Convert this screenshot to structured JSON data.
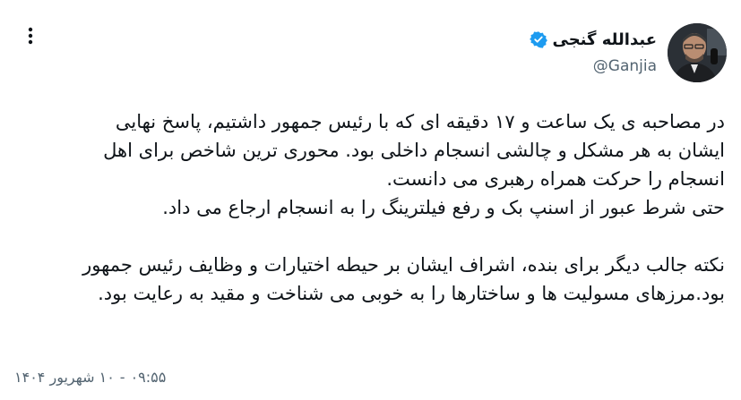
{
  "author": {
    "display_name": "عبدالله گنجی",
    "handle": "@Ganjia",
    "verified": true,
    "verified_color": "#1d9bf0"
  },
  "tweet": {
    "paragraph1": [
      "در مصاحبه ی یک ساعت و ۱۷ دقیقه ای که با رئیس جمهور  داشتیم، پاسخ نهایی",
      "ایشان به هر مشکل و چالشی انسجام داخلی بود. محوری ترین شاخص برای اهل",
      "انسجام را حرکت همراه رهبری می دانست.",
      "حتی شرط عبور از اسنپ بک و رفع فیلترینگ را به انسجام ارجاع می داد."
    ],
    "paragraph2": [
      "نکته جالب دیگر برای بنده، اشراف ایشان بر حیطه اختیارات و وظایف رئیس جمهور",
      "بود.مرزهای مسولیت ها و ساختارها را به خوبی می شناخت و مقید به رعایت بود."
    ],
    "time": "۰۹:۵۵",
    "separator": "-",
    "date": "۱۰ شهریور ۱۴۰۴"
  },
  "icons": {
    "more": "more-vertical-icon",
    "verified": "verified-badge-icon"
  }
}
